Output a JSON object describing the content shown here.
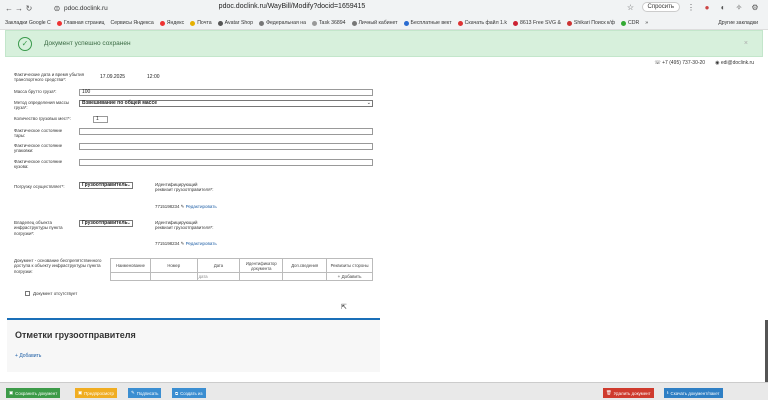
{
  "browser": {
    "url": "pdoc.doclink.ru/WayBill/Modify?docid=1659415",
    "site": "pdoc.doclink.ru",
    "ask": "Спросить",
    "bookmarks": [
      "Закладки Google C",
      "Главная страниц",
      "Сервисы Яндекса",
      "Яндекс",
      "Почта",
      "Avatar Shop",
      "Федеральная на",
      "Task 36894",
      "Личный кабинет",
      "Бесплатные вект",
      "Скачать файл 1.k",
      "8613 Free SVG &",
      "Shikari Поиск к/ф",
      "CDR",
      "»"
    ],
    "other_bookmarks": "Другие закладки"
  },
  "alert": {
    "message": "Документ успешно сохранен",
    "close": "×"
  },
  "contact": {
    "phone": "+7 (495) 737-30-20",
    "email": "edi@doclink.ru"
  },
  "form": {
    "actual_date_label": "Фактические дата и время убытия транспортного средства*:",
    "actual_date": "17.09.2025",
    "actual_time": "12:00",
    "gross_mass_label": "Масса брутто груза*:",
    "gross_mass": "100",
    "mass_method_label": "Метод определения массы груза*:",
    "mass_method": "Взвешивание по общей массе",
    "cargo_places_label": "Количество грузовых мест*:",
    "cargo_places": "1",
    "container_state_label": "Фактическое состояние тары:",
    "packaging_state_label": "Фактическое состояние упаковки:",
    "body_state_label": "Фактическое состояние кузова:",
    "loading_by_label": "Погрузку осуществляет*:",
    "loading_by": "Грузоотправитель",
    "loading_id_label": "Идентифицирующий реквизит грузоотправителя*:",
    "loading_id": "7715198234",
    "edit_link": "Редактировать",
    "owner_label": "Владелец объекта инфраструктуры пункта погрузки*:",
    "owner": "Грузоотправитель",
    "owner_id_label": "Идентифицирующий реквизит грузоотправителя*:",
    "owner_id": "7715198234",
    "doc_label": "Документ - основание беспрепятственного доступа к объекту инфраструктуры пункта погрузки:",
    "table_headers": [
      "Наименование",
      "Номер",
      "Дата",
      "Идентификатор документа",
      "Доп.сведения",
      "Реквизиты стороны"
    ],
    "date_placeholder": "дата",
    "add_label": "Добавить",
    "no_document_label": "Документ отсутствует"
  },
  "section": {
    "title": "Отметки грузоотправителя",
    "add": "Добавить"
  },
  "footer": {
    "save": "Сохранить документ",
    "preview": "Предпросмотр",
    "sign": "Подписать",
    "create": "Создать из",
    "delete": "Удалить документ",
    "download": "Скачать документ/пакет"
  },
  "colors": {
    "save": "#3c9a48",
    "preview": "#f0ad22",
    "sign": "#3b8ed1",
    "create": "#3b8ed1",
    "delete": "#cf3b2e",
    "download": "#2f7fc4",
    "accent": "#1a6fb8"
  }
}
